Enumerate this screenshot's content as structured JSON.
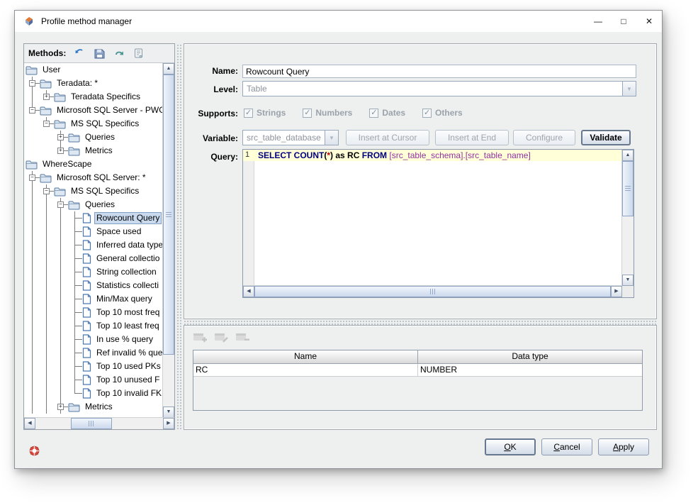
{
  "window": {
    "title": "Profile method manager",
    "minimize_glyph": "—",
    "maximize_glyph": "□",
    "close_glyph": "✕"
  },
  "methods_toolbar": {
    "label": "Methods:",
    "icons": [
      "refresh-icon",
      "save-icon",
      "undo-icon",
      "script-icon"
    ]
  },
  "tree": {
    "continues_below": [
      1,
      2,
      3
    ],
    "items": [
      {
        "label": "User",
        "depth": 0,
        "icon": "folder",
        "handle": "none",
        "selected": false
      },
      {
        "label": "Teradata: *",
        "depth": 1,
        "icon": "folder",
        "handle": "minus",
        "selected": false
      },
      {
        "label": "Teradata Specifics",
        "depth": 2,
        "icon": "folder",
        "handle": "plus",
        "selected": false
      },
      {
        "label": "Microsoft SQL Server - PWG",
        "depth": 1,
        "icon": "folder",
        "handle": "minus",
        "selected": false
      },
      {
        "label": "MS SQL Specifics",
        "depth": 2,
        "icon": "folder",
        "handle": "minus",
        "selected": false
      },
      {
        "label": "Queries",
        "depth": 3,
        "icon": "folder",
        "handle": "plus",
        "selected": false
      },
      {
        "label": "Metrics",
        "depth": 3,
        "icon": "folder",
        "handle": "plus",
        "selected": false
      },
      {
        "label": "WhereScape",
        "depth": 0,
        "icon": "folder",
        "handle": "none",
        "selected": false
      },
      {
        "label": "Microsoft SQL Server: *",
        "depth": 1,
        "icon": "folder",
        "handle": "minus",
        "selected": false
      },
      {
        "label": "MS SQL Specifics",
        "depth": 2,
        "icon": "folder",
        "handle": "minus",
        "selected": false
      },
      {
        "label": "Queries",
        "depth": 3,
        "icon": "folder",
        "handle": "minus",
        "selected": false
      },
      {
        "label": "Rowcount Query",
        "depth": 4,
        "icon": "doc",
        "handle": "none",
        "selected": true
      },
      {
        "label": "Space used",
        "depth": 4,
        "icon": "doc",
        "handle": "none",
        "selected": false
      },
      {
        "label": "Inferred data type",
        "depth": 4,
        "icon": "doc",
        "handle": "none",
        "selected": false
      },
      {
        "label": "General collectio",
        "depth": 4,
        "icon": "doc",
        "handle": "none",
        "selected": false
      },
      {
        "label": "String collection",
        "depth": 4,
        "icon": "doc",
        "handle": "none",
        "selected": false
      },
      {
        "label": "Statistics collecti",
        "depth": 4,
        "icon": "doc",
        "handle": "none",
        "selected": false
      },
      {
        "label": "Min/Max query",
        "depth": 4,
        "icon": "doc",
        "handle": "none",
        "selected": false
      },
      {
        "label": "Top 10 most freq",
        "depth": 4,
        "icon": "doc",
        "handle": "none",
        "selected": false
      },
      {
        "label": "Top 10 least freq",
        "depth": 4,
        "icon": "doc",
        "handle": "none",
        "selected": false
      },
      {
        "label": "In use % query",
        "depth": 4,
        "icon": "doc",
        "handle": "none",
        "selected": false
      },
      {
        "label": "Ref invalid % que",
        "depth": 4,
        "icon": "doc",
        "handle": "none",
        "selected": false
      },
      {
        "label": "Top 10 used PKs",
        "depth": 4,
        "icon": "doc",
        "handle": "none",
        "selected": false
      },
      {
        "label": "Top 10 unused F",
        "depth": 4,
        "icon": "doc",
        "handle": "none",
        "selected": false
      },
      {
        "label": "Top 10 invalid FK",
        "depth": 4,
        "icon": "doc",
        "handle": "none",
        "selected": false
      },
      {
        "label": "Metrics",
        "depth": 3,
        "icon": "folder",
        "handle": "plus",
        "selected": false
      }
    ]
  },
  "editor": {
    "name_label": "Name:",
    "name_value": "Rowcount Query",
    "level_label": "Level:",
    "level_value": "Table",
    "supports_label": "Supports:",
    "supports": [
      {
        "label": "Strings",
        "checked": true
      },
      {
        "label": "Numbers",
        "checked": true
      },
      {
        "label": "Dates",
        "checked": true
      },
      {
        "label": "Others",
        "checked": true
      }
    ],
    "variable_label": "Variable:",
    "variable_value": "src_table_database",
    "insert_at_cursor_label": "Insert at Cursor",
    "insert_at_end_label": "Insert at End",
    "configure_label": "Configure",
    "validate_label": "Validate",
    "query_label": "Query:",
    "query_line_number": "1",
    "query_tokens": [
      {
        "text": "SELECT COUNT",
        "style": "keyword"
      },
      {
        "text": "(",
        "style": "plain"
      },
      {
        "text": "*",
        "style": "star"
      },
      {
        "text": ")",
        "style": "plain"
      },
      {
        "text": " as RC ",
        "style": "plain"
      },
      {
        "text": "FROM",
        "style": "keyword"
      },
      {
        "text": " [src_table_schema].[src_table_name]",
        "style": "ident"
      }
    ]
  },
  "results": {
    "columns": [
      "Name",
      "Data type"
    ],
    "rows": [
      [
        "RC",
        "NUMBER"
      ]
    ]
  },
  "footer": {
    "buttons": [
      {
        "id": "ok",
        "label": "OK",
        "mnemonic_index": 0,
        "default": true
      },
      {
        "id": "cancel",
        "label": "Cancel",
        "mnemonic_index": 0,
        "default": false
      },
      {
        "id": "apply",
        "label": "Apply",
        "mnemonic_index": 0,
        "default": false
      }
    ]
  },
  "colors": {
    "selection_bg": "#c9daee",
    "selection_border": "#82a0c2",
    "active_line": "#ffffd8",
    "keyword": "#000080",
    "identifier": "#9331a3",
    "star": "#c00000",
    "accent_blue": "#2e78c8"
  }
}
